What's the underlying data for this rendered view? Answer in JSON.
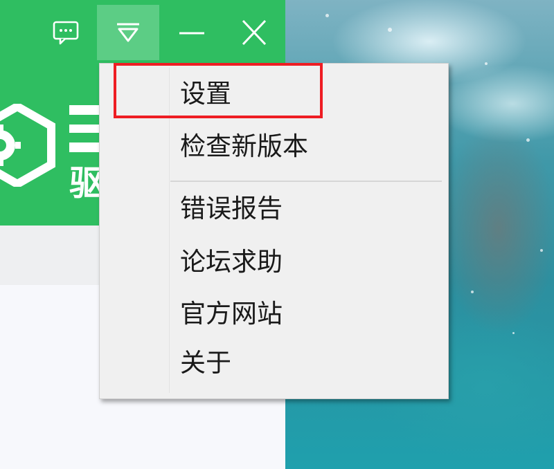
{
  "titlebar": {
    "buttons": [
      {
        "name": "feedback",
        "icon": "chat-bubble-icon"
      },
      {
        "name": "menu",
        "icon": "dropdown-triangle-icon"
      },
      {
        "name": "minimize",
        "icon": "minimize-icon"
      },
      {
        "name": "close",
        "icon": "close-icon"
      }
    ]
  },
  "logo": {
    "icon": "gear-shield-logo",
    "partial_text": "驱"
  },
  "menu": {
    "items": [
      {
        "label": "设置",
        "highlighted": true
      },
      {
        "label": "检查新版本"
      },
      {
        "label": "错误报告"
      },
      {
        "label": "论坛求助"
      },
      {
        "label": "官方网站"
      },
      {
        "label": "关于"
      }
    ]
  },
  "colors": {
    "brand_green": "#2fbe61",
    "active_button_green": "#5ccd85",
    "menu_background": "#f0f0f0",
    "highlight_red": "#ee1d23"
  }
}
